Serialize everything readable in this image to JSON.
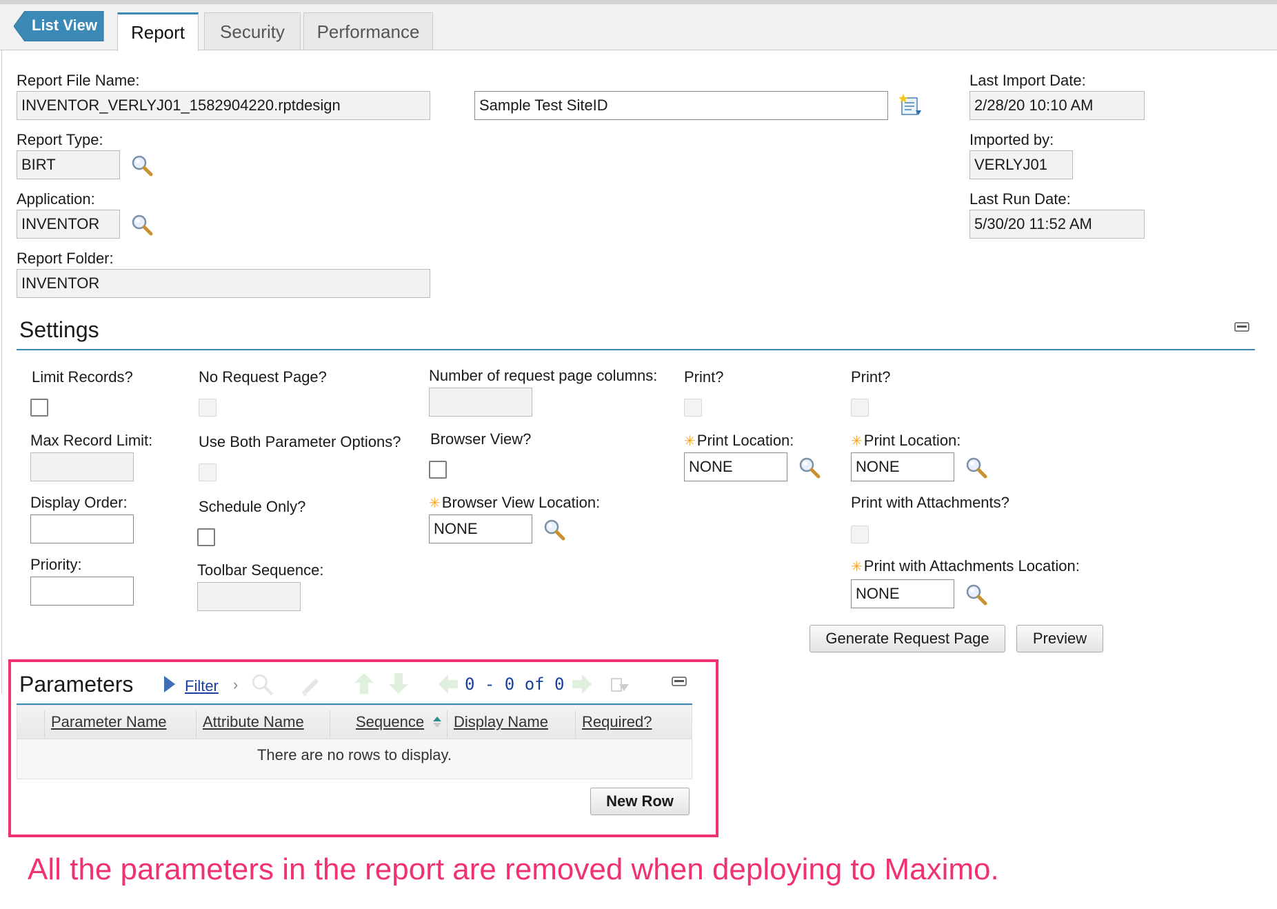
{
  "tabs": {
    "list_view": "List View",
    "items": [
      "Report",
      "Security",
      "Performance"
    ],
    "active": "Report"
  },
  "report": {
    "file_name_label": "Report File Name:",
    "file_name": "INVENTOR_VERLYJ01_1582904220.rptdesign",
    "description": "Sample Test SiteID",
    "type_label": "Report Type:",
    "type": "BIRT",
    "application_label": "Application:",
    "application": "INVENTOR",
    "folder_label": "Report Folder:",
    "folder": "INVENTOR",
    "last_import_label": "Last Import Date:",
    "last_import": "2/28/20 10:10 AM",
    "imported_by_label": "Imported by:",
    "imported_by": "VERLYJ01",
    "last_run_label": "Last Run Date:",
    "last_run": "5/30/20 11:52 AM"
  },
  "settings": {
    "title": "Settings",
    "limit_records": "Limit Records?",
    "max_record_limit": "Max Record Limit:",
    "display_order": "Display Order:",
    "priority": "Priority:",
    "no_request_page": "No Request Page?",
    "use_both": "Use Both Parameter Options?",
    "schedule_only": "Schedule Only?",
    "toolbar_sequence": "Toolbar Sequence:",
    "num_columns": "Number of request page columns:",
    "browser_view": "Browser View?",
    "browser_view_location": "Browser View Location:",
    "browser_view_location_value": "NONE",
    "print1": "Print?",
    "print_location1": "Print Location:",
    "print_location1_value": "NONE",
    "print2": "Print?",
    "print_location2": "Print Location:",
    "print_location2_value": "NONE",
    "print_attachments": "Print with Attachments?",
    "print_attachments_location": "Print with Attachments Location:",
    "print_attachments_location_value": "NONE",
    "generate_button": "Generate Request Page",
    "preview_button": "Preview"
  },
  "parameters": {
    "title": "Parameters",
    "filter": "Filter",
    "pagination": "0 - 0 of 0",
    "columns": [
      "Parameter Name",
      "Attribute Name",
      "Sequence",
      "Display Name",
      "Required?"
    ],
    "empty_message": "There are no rows to display.",
    "new_row_button": "New Row"
  },
  "annotation": {
    "text": "All the parameters in the report are removed when deploying to Maximo.",
    "color": "#f0326e"
  },
  "colors": {
    "accent": "#3b89b6",
    "required": "#f5a623",
    "highlight": "#f0326e"
  }
}
